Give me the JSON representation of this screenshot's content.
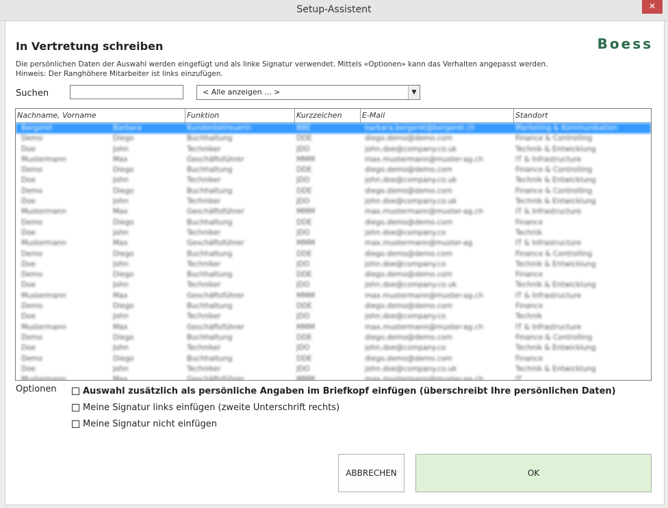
{
  "window": {
    "title": "Setup-Assistent",
    "close_glyph": "✕"
  },
  "header": {
    "title": "In Vertretung schreiben",
    "brand": "Boess",
    "description_line1": "Die persönlichen Daten der Auswahl werden eingefügt und als linke Signatur verwendet. Mittels «Optionen» kann das Verhalten angepasst werden.",
    "description_line2": "Hinweis: Der Ranghöhere Mitarbeiter ist links einzufügen."
  },
  "search": {
    "label": "Suchen",
    "value": "",
    "filter_value": "< Alle anzeigen ... >"
  },
  "table": {
    "columns": [
      "Nachname, Vorname",
      "Funktion",
      "Kurzzeichen",
      "E-Mail",
      "Standort"
    ],
    "rows": [
      [
        "Bergeret",
        "Barbara",
        "Kundenbetreuerin",
        "BBE",
        "barbara.bergeret@bergeret.ch",
        "Marketing & Kommunikation"
      ],
      [
        "Demo",
        "Diego",
        "Buchhaltung",
        "DDE",
        "diego.demo@demo.com",
        "Finance & Controlling"
      ],
      [
        "Doe",
        "John",
        "Techniker",
        "JDO",
        "john.doe@company.co.uk",
        "Technik & Entwicklung"
      ],
      [
        "Mustermann",
        "Max",
        "Geschäftsführer",
        "MMM",
        "max.mustermann@muster-ag.ch",
        "IT & Infrastructure"
      ],
      [
        "Demo",
        "Diego",
        "Buchhaltung",
        "DDE",
        "diego.demo@demo.com",
        "Finance & Controlling"
      ],
      [
        "Doe",
        "John",
        "Techniker",
        "JDO",
        "john.doe@company.co.uk",
        "Technik & Entwicklung"
      ],
      [
        "Demo",
        "Diego",
        "Buchhaltung",
        "DDE",
        "diego.demo@demo.com",
        "Finance & Controlling"
      ],
      [
        "Doe",
        "John",
        "Techniker",
        "JDO",
        "john.doe@company.co.uk",
        "Technik & Entwicklung"
      ],
      [
        "Mustermann",
        "Max",
        "Geschäftsführer",
        "MMM",
        "max.mustermann@muster-ag.ch",
        "IT & Infrastructure"
      ],
      [
        "Demo",
        "Diego",
        "Buchhaltung",
        "DDE",
        "diego.demo@demo.com",
        "Finance"
      ],
      [
        "Doe",
        "John",
        "Techniker",
        "JDO",
        "john.doe@company.co",
        "Technik"
      ],
      [
        "Mustermann",
        "Max",
        "Geschäftsführer",
        "MMM",
        "max.mustermann@muster-ag",
        "IT & Infrastructure"
      ],
      [
        "Demo",
        "Diego",
        "Buchhaltung",
        "DDE",
        "diego.demo@demo.com",
        "Finance & Controlling"
      ],
      [
        "Doe",
        "John",
        "Techniker",
        "JDO",
        "john.doe@company.co",
        "Technik & Entwicklung"
      ],
      [
        "Demo",
        "Diego",
        "Buchhaltung",
        "DDE",
        "diego.demo@demo.com",
        "Finance"
      ],
      [
        "Doe",
        "John",
        "Techniker",
        "JDO",
        "john.doe@company.co.uk",
        "Technik & Entwicklung"
      ],
      [
        "Mustermann",
        "Max",
        "Geschäftsführer",
        "MMM",
        "max.mustermann@muster-ag.ch",
        "IT & Infrastructure"
      ],
      [
        "Demo",
        "Diego",
        "Buchhaltung",
        "DDE",
        "diego.demo@demo.com",
        "Finance"
      ],
      [
        "Doe",
        "John",
        "Techniker",
        "JDO",
        "john.doe@company.co",
        "Technik"
      ],
      [
        "Mustermann",
        "Max",
        "Geschäftsführer",
        "MMM",
        "max.mustermann@muster-ag.ch",
        "IT & Infrastructure"
      ],
      [
        "Demo",
        "Diego",
        "Buchhaltung",
        "DDE",
        "diego.demo@demo.com",
        "Finance & Controlling"
      ],
      [
        "Doe",
        "John",
        "Techniker",
        "JDO",
        "john.doe@company.co",
        "Technik & Entwicklung"
      ],
      [
        "Demo",
        "Diego",
        "Buchhaltung",
        "DDE",
        "diego.demo@demo.com",
        "Finance"
      ],
      [
        "Doe",
        "John",
        "Techniker",
        "JDO",
        "john.doe@company.co.uk",
        "Technik & Entwicklung"
      ],
      [
        "Mustermann",
        "Max",
        "Geschäftsführer",
        "MMM",
        "max.mustermann@muster-ag.ch",
        "IT"
      ]
    ],
    "selected_row": 0
  },
  "options": {
    "label": "Optionen",
    "items": [
      {
        "label": "Auswahl zusätzlich  als persönliche Angaben im Briefkopf einfügen (überschreibt Ihre persönlichen Daten)",
        "checked": false
      },
      {
        "label": "Meine Signatur links einfügen (zweite Unterschrift rechts)",
        "checked": false
      },
      {
        "label": "Meine Signatur nicht einfügen",
        "checked": false
      }
    ]
  },
  "buttons": {
    "cancel": "ABBRECHEN",
    "ok": "OK"
  },
  "colors": {
    "brand": "#2c6b4a",
    "selection": "#3399ff",
    "ok_bg": "#def2d7",
    "close": "#c74a4a"
  }
}
